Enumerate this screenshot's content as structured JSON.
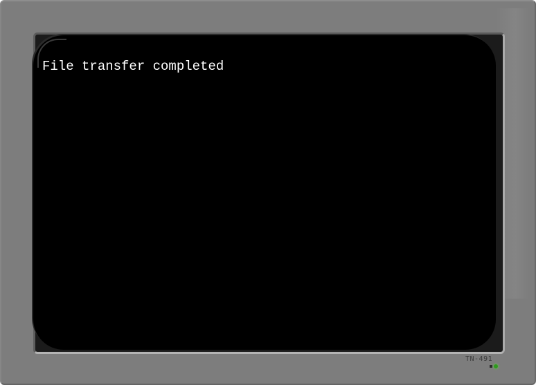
{
  "terminal": {
    "output_text": "File transfer completed"
  },
  "monitor": {
    "model_label": "TN-491",
    "power_led_color": "#2f9a1f",
    "bezel_color": "#7d7d7d",
    "screen_color": "#000000"
  }
}
